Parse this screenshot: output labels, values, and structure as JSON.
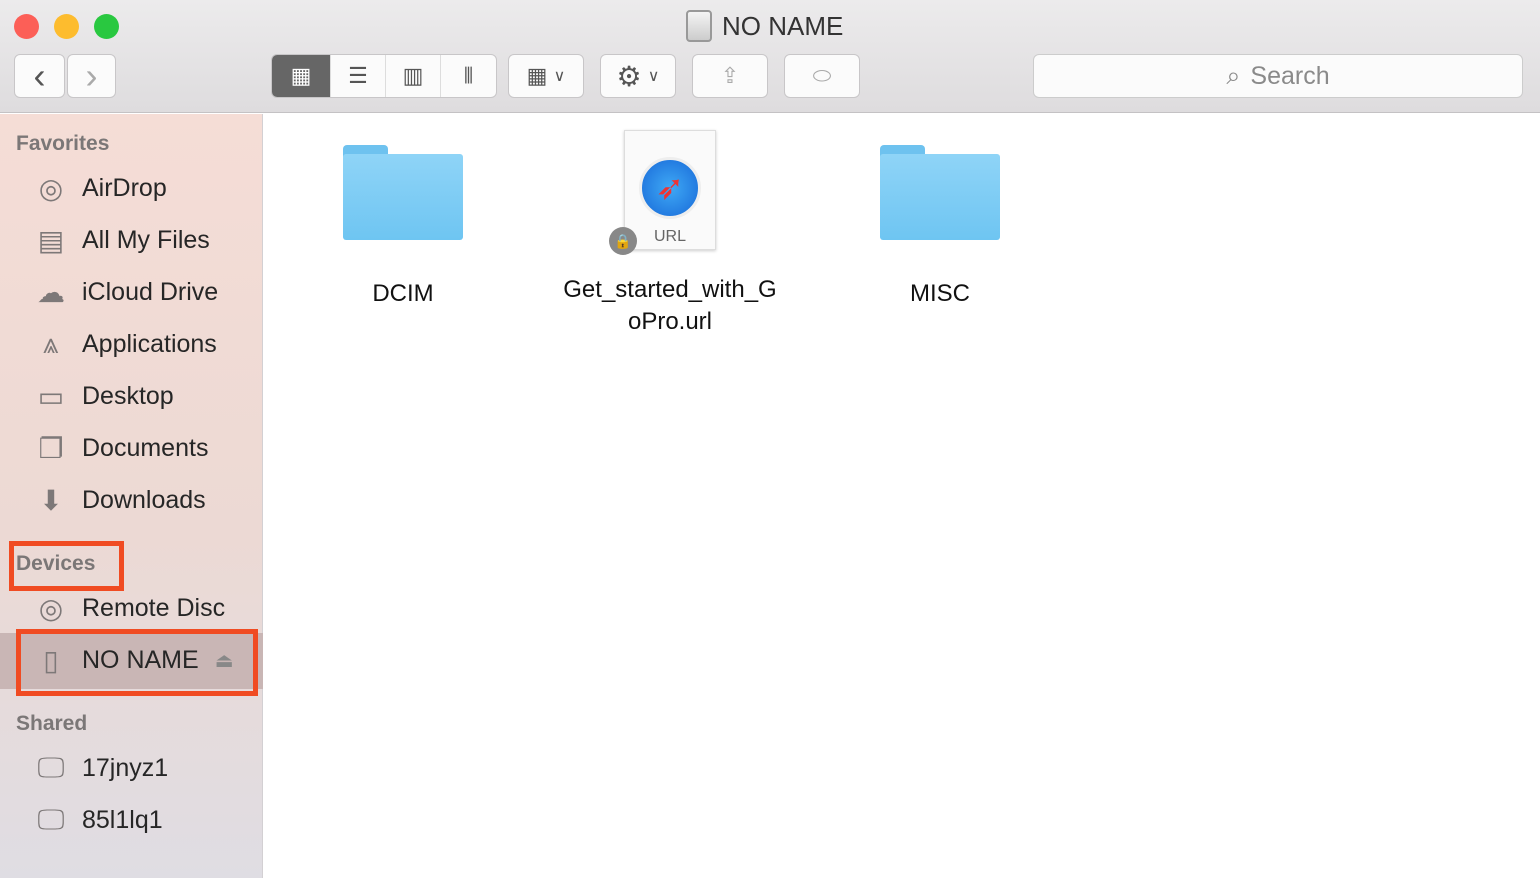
{
  "window": {
    "title": "NO NAME"
  },
  "toolbar": {
    "back": "‹",
    "forward": "›",
    "search_placeholder": "Search",
    "views": [
      "icon-view",
      "list-view",
      "column-view",
      "cover-flow-view"
    ]
  },
  "sidebar": {
    "favorites_header": "Favorites",
    "favorites": [
      {
        "label": "AirDrop",
        "icon": "airdrop-icon"
      },
      {
        "label": "All My Files",
        "icon": "all-files-icon"
      },
      {
        "label": "iCloud Drive",
        "icon": "cloud-icon"
      },
      {
        "label": "Applications",
        "icon": "applications-icon"
      },
      {
        "label": "Desktop",
        "icon": "desktop-icon"
      },
      {
        "label": "Documents",
        "icon": "documents-icon"
      },
      {
        "label": "Downloads",
        "icon": "downloads-icon"
      }
    ],
    "devices_header": "Devices",
    "devices": [
      {
        "label": "Remote Disc",
        "icon": "disc-icon"
      },
      {
        "label": "NO NAME",
        "icon": "drive-icon",
        "selected": true
      }
    ],
    "shared_header": "Shared",
    "shared": [
      {
        "label": "17jnyz1",
        "icon": "computer-icon"
      },
      {
        "label": "85l1lq1",
        "icon": "computer-icon"
      }
    ]
  },
  "files": [
    {
      "name": "DCIM",
      "type": "folder"
    },
    {
      "name": "Get_started_with_GoPro.url",
      "line1": "Get_started_with_G",
      "line2": "oPro.url",
      "type": "url",
      "badge": "URL"
    },
    {
      "name": "MISC",
      "type": "folder"
    }
  ],
  "colors": {
    "highlight": "#f04b22",
    "folder": "#7ccbf3"
  }
}
